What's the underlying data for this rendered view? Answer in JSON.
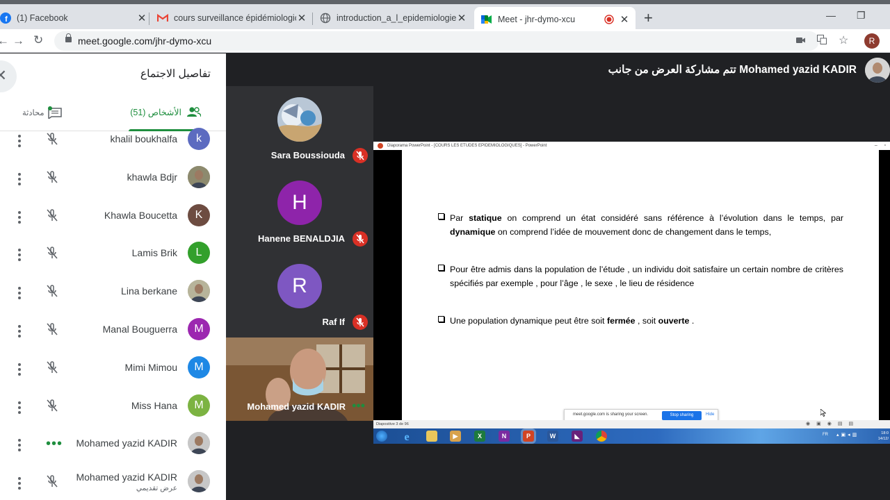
{
  "browser": {
    "tabs": [
      {
        "title": "(1) Facebook",
        "icon": "facebook-icon"
      },
      {
        "title": "cours surveillance épidémiologic",
        "icon": "gmail-icon"
      },
      {
        "title": "introduction_a_l_epidemiologie.p",
        "icon": "globe-icon"
      },
      {
        "title": "Meet - jhr-dymo-xcu",
        "icon": "meet-icon",
        "active": true
      }
    ],
    "url": "meet.google.com/jhr-dymo-xcu",
    "profile_initial": "R"
  },
  "side_panel": {
    "title": "تفاصيل الاجتماع",
    "people_tab": "الأشخاص (51)",
    "chat_tab": "محادثة",
    "participants": [
      {
        "name": "khalil boukhalfa",
        "initial": "k",
        "color": "#5c6bc0",
        "status": "muted"
      },
      {
        "name": "khawla Bdjr",
        "initial": "",
        "color": "#8d8a6e",
        "status": "muted"
      },
      {
        "name": "Khawla Boucetta",
        "initial": "K",
        "color": "#6d4c41",
        "status": "muted"
      },
      {
        "name": "Lamis Brik",
        "initial": "L",
        "color": "#33a02c",
        "status": "muted"
      },
      {
        "name": "Lina berkane",
        "initial": "",
        "color": "#b7b49a",
        "status": "muted"
      },
      {
        "name": "Manal Bouguerra",
        "initial": "M",
        "color": "#9c27b0",
        "status": "muted"
      },
      {
        "name": "Mimi Mimou",
        "initial": "M",
        "color": "#1e88e5",
        "status": "muted"
      },
      {
        "name": "Miss Hana",
        "initial": "M",
        "color": "#7cb342",
        "status": "muted"
      },
      {
        "name": "Mohamed yazid KADIR",
        "initial": "",
        "color": "#c7c7c7",
        "status": "speaking"
      },
      {
        "name": "Mohamed yazid KADIR",
        "subtitle": "عرض تقديمي",
        "initial": "",
        "color": "#c7c7c7",
        "status": "presenting"
      }
    ]
  },
  "meet": {
    "presenting_label": "تتم مشاركة العرض من جانب Mohamed yazid KADIR",
    "tiles": [
      {
        "name": "Sara Boussiouda",
        "initial": "",
        "color": "#5a7fa0"
      },
      {
        "name": "Hanene BENALDJIA",
        "initial": "H",
        "color": "#8e24aa"
      },
      {
        "name": "Raf If",
        "initial": "R",
        "color": "#7e57c2"
      }
    ],
    "camera_tile_name": "Mohamed yazid KADIR"
  },
  "powerpoint": {
    "window_title": "Diaporama PowerPoint - [COURS LES ETUDES EPIDEMIOLOGIQUES] - PowerPoint",
    "status_text": "Diapositive 3 de 96",
    "share_message": "meet.google.com is sharing your screen.",
    "stop_sharing": "Stop sharing",
    "hide": "Hide",
    "tray_time": "18:0",
    "tray_date": "14/12/",
    "tray_lang": "FR",
    "taskbar_letters": [
      "X",
      "N",
      "P",
      "W"
    ],
    "slide_bullets": [
      {
        "parts": [
          {
            "t": "Par ",
            "b": false
          },
          {
            "t": "statique",
            "b": true
          },
          {
            "t": " on comprend un état considéré sans référence à l’évolution dans le temps, par ",
            "b": false
          },
          {
            "t": "dynamique",
            "b": true
          },
          {
            "t": " on comprend l’idée de mouvement donc de changement dans le temps,",
            "b": false
          }
        ]
      },
      {
        "parts": [
          {
            "t": "Pour être admis dans la population de l’étude , un individu doit satisfaire un certain nombre de critères spécifiés par exemple , pour l’âge , le sexe , le lieu de résidence",
            "b": false
          }
        ]
      },
      {
        "parts": [
          {
            "t": "Une population dynamique peut être soit ",
            "b": false
          },
          {
            "t": "fermée",
            "b": true
          },
          {
            "t": " , soit ",
            "b": false
          },
          {
            "t": "ouverte",
            "b": true
          },
          {
            "t": " .",
            "b": false
          }
        ]
      }
    ]
  }
}
